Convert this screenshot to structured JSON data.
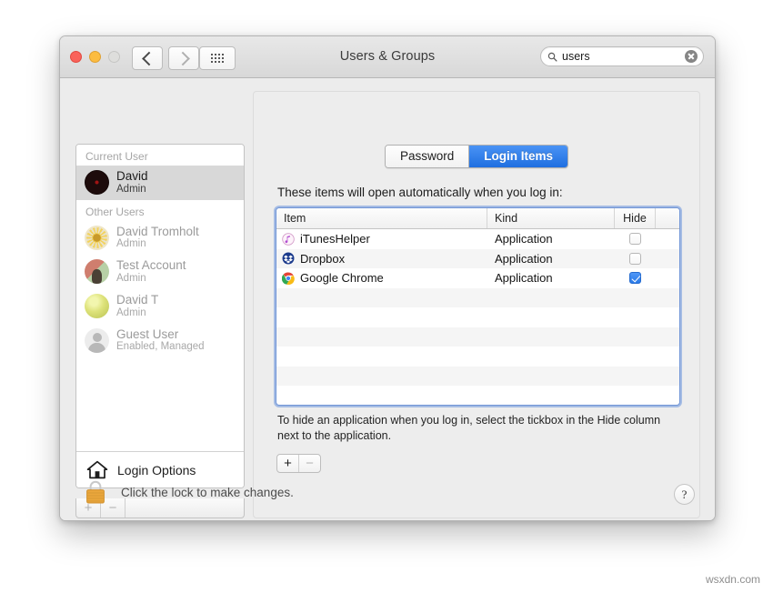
{
  "window": {
    "title": "Users & Groups",
    "traffic_lights": [
      "close",
      "minimize",
      "zoom-disabled"
    ],
    "nav": {
      "back_icon": "chevron-left-icon",
      "forward_icon": "chevron-right-icon",
      "showall_icon": "grid-icon"
    }
  },
  "search": {
    "value": "users",
    "placeholder": "Search",
    "icon": "search-icon",
    "clear_icon": "clear-circle-icon"
  },
  "sidebar": {
    "groups": [
      {
        "header": "Current User",
        "users": [
          {
            "name": "David",
            "role": "Admin",
            "avatar": "record-avatar",
            "selected": true,
            "dim": false
          }
        ]
      },
      {
        "header": "Other Users",
        "users": [
          {
            "name": "David Tromholt",
            "role": "Admin",
            "avatar": "flower-avatar",
            "selected": false,
            "dim": true
          },
          {
            "name": "Test Account",
            "role": "Admin",
            "avatar": "portrait-avatar",
            "selected": false,
            "dim": true
          },
          {
            "name": "David T",
            "role": "Admin",
            "avatar": "ball-avatar",
            "selected": false,
            "dim": true
          },
          {
            "name": "Guest User",
            "role": "Enabled, Managed",
            "avatar": "guest-avatar",
            "selected": false,
            "dim": true
          }
        ]
      }
    ],
    "login_options": {
      "label": "Login Options",
      "icon": "home-icon"
    },
    "add_label": "+",
    "remove_label": "−"
  },
  "main": {
    "tabs": [
      {
        "label": "Password",
        "active": false
      },
      {
        "label": "Login Items",
        "active": true
      }
    ],
    "intro": "These items will open automatically when you log in:",
    "table": {
      "columns": [
        "Item",
        "Kind",
        "Hide"
      ],
      "rows": [
        {
          "item": "iTunesHelper",
          "kind": "Application",
          "hide": false,
          "icon": "itunes-icon"
        },
        {
          "item": "Dropbox",
          "kind": "Application",
          "hide": false,
          "icon": "dropbox-icon"
        },
        {
          "item": "Google Chrome",
          "kind": "Application",
          "hide": true,
          "icon": "chrome-icon"
        }
      ],
      "empty_row_count": 7
    },
    "hint": "To hide an application when you log in, select the tickbox in the Hide column next to the application.",
    "add_label": "+",
    "remove_label": "−"
  },
  "footer": {
    "lock_message": "Click the lock to make changes.",
    "lock_icon": "lock-closed-icon",
    "help_label": "?"
  },
  "watermark": "wsxdn.com",
  "colors": {
    "accent": "#2a7ae8",
    "tab_active": "#2f7ee4",
    "lock_gold": "#e8a33d",
    "focus_ring": "#6f94d6"
  }
}
